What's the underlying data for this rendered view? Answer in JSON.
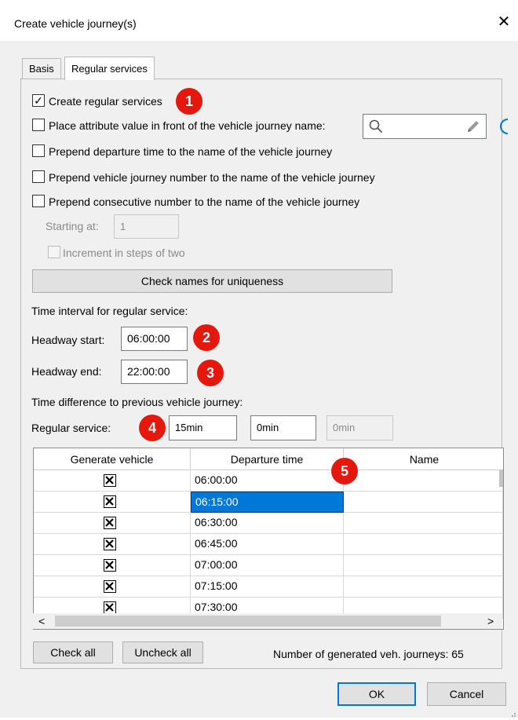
{
  "dialog": {
    "title": "Create vehicle journey(s)",
    "close_glyph": "✕"
  },
  "tabs": [
    {
      "label": "Basis",
      "active": false
    },
    {
      "label": "Regular services",
      "active": true
    }
  ],
  "options": {
    "create_regular": {
      "label": "Create regular services",
      "checked": true
    },
    "place_attribute": {
      "label": "Place attribute value in front of the vehicle journey name:",
      "checked": false
    },
    "prepend_departure": {
      "label": "Prepend departure time to the name of the vehicle journey",
      "checked": false
    },
    "prepend_journey_number": {
      "label": "Prepend vehicle journey number to the name of the vehicle journey",
      "checked": false
    },
    "prepend_consecutive": {
      "label": "Prepend consecutive number to the name of the vehicle journey",
      "checked": false
    }
  },
  "attribute_field": {
    "icons": [
      "search-icon",
      "pencil-icon"
    ]
  },
  "starting_at": {
    "label": "Starting at:",
    "value": "1"
  },
  "increment": {
    "label": "Increment in steps of two",
    "checked": false
  },
  "check_names_button": "Check names for uniqueness",
  "interval": {
    "heading": "Time interval for regular service:",
    "start_label": "Headway start:",
    "start_value": "06:00:00",
    "end_label": "Headway end:",
    "end_value": "22:00:00"
  },
  "difference": {
    "heading": "Time difference to previous vehicle journey:",
    "regular_label": "Regular service:",
    "values": [
      "15min",
      "0min",
      "0min"
    ]
  },
  "table": {
    "columns": [
      "Generate vehicle",
      "Departure time",
      "Name"
    ],
    "rows": [
      {
        "generate": true,
        "departure": "06:00:00",
        "name": ""
      },
      {
        "generate": true,
        "departure": "06:15:00",
        "name": "",
        "selected": true
      },
      {
        "generate": true,
        "departure": "06:30:00",
        "name": ""
      },
      {
        "generate": true,
        "departure": "06:45:00",
        "name": ""
      },
      {
        "generate": true,
        "departure": "07:00:00",
        "name": ""
      },
      {
        "generate": true,
        "departure": "07:15:00",
        "name": ""
      },
      {
        "generate": true,
        "departure": "07:30:00",
        "name": ""
      }
    ]
  },
  "scroll_arrows": {
    "left": "<",
    "right": ">"
  },
  "buttons": {
    "check_all": "Check all",
    "uncheck_all": "Uncheck all",
    "ok": "OK",
    "cancel": "Cancel"
  },
  "summary": "Number of generated veh. journeys: 65",
  "badges": [
    "1",
    "2",
    "3",
    "4",
    "5"
  ],
  "colors": {
    "badge": "#e5180d",
    "selection": "#0078d7"
  }
}
